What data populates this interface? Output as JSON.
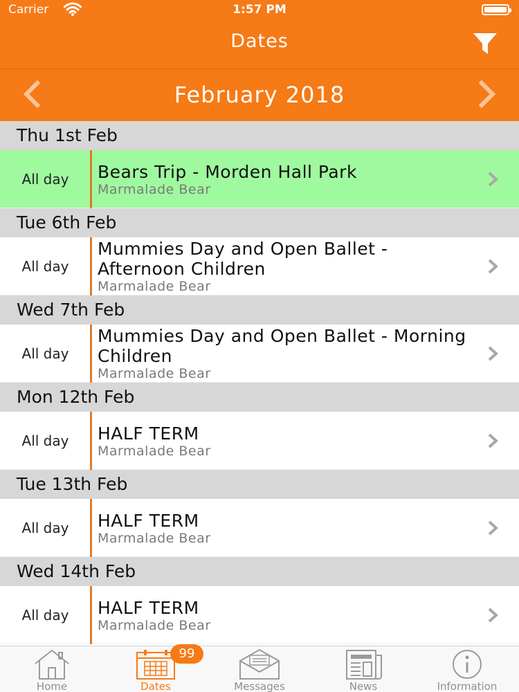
{
  "status_bar": {
    "carrier": "Carrier",
    "time": "1:57 PM"
  },
  "nav": {
    "title": "Dates"
  },
  "month": {
    "label": "February 2018"
  },
  "days": [
    {
      "date": "Thu 1st Feb",
      "events": [
        {
          "time": "All day",
          "title": "Bears Trip - Morden Hall Park",
          "subtitle": "Marmalade Bear",
          "highlighted": true
        }
      ]
    },
    {
      "date": "Tue 6th Feb",
      "events": [
        {
          "time": "All day",
          "title": "Mummies Day and Open Ballet - Afternoon Children",
          "subtitle": "Marmalade Bear",
          "highlighted": false
        }
      ]
    },
    {
      "date": "Wed 7th Feb",
      "events": [
        {
          "time": "All day",
          "title": "Mummies Day and Open Ballet - Morning Children",
          "subtitle": "Marmalade Bear",
          "highlighted": false
        }
      ]
    },
    {
      "date": "Mon 12th Feb",
      "events": [
        {
          "time": "All day",
          "title": "HALF TERM",
          "subtitle": "Marmalade Bear",
          "highlighted": false
        }
      ]
    },
    {
      "date": "Tue 13th Feb",
      "events": [
        {
          "time": "All day",
          "title": "HALF TERM",
          "subtitle": "Marmalade Bear",
          "highlighted": false
        }
      ]
    },
    {
      "date": "Wed 14th Feb",
      "events": [
        {
          "time": "All day",
          "title": "HALF TERM",
          "subtitle": "Marmalade Bear",
          "highlighted": false
        }
      ]
    }
  ],
  "tabs": [
    {
      "label": "Home",
      "icon": "home-icon",
      "active": false
    },
    {
      "label": "Dates",
      "icon": "calendar-icon",
      "active": true
    },
    {
      "label": "Messages",
      "icon": "envelope-icon",
      "active": false,
      "badge": "99"
    },
    {
      "label": "News",
      "icon": "newspaper-icon",
      "active": false
    },
    {
      "label": "Information",
      "icon": "info-icon",
      "active": false
    }
  ],
  "colors": {
    "brand": "#f67a16",
    "highlight": "#9ff99f",
    "header_bg": "#d7d7d7"
  }
}
